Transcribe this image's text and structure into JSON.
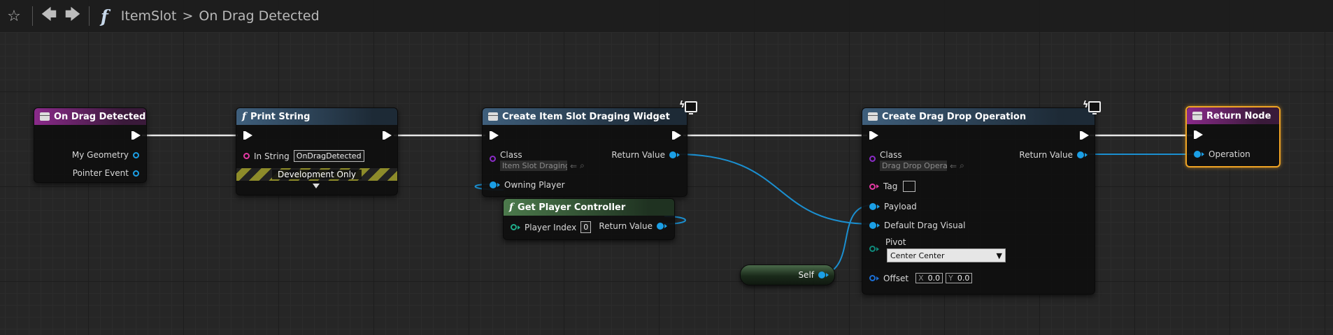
{
  "toolbar": {
    "breadcrumb": {
      "blueprint": "ItemSlot",
      "separator": ">",
      "function": "On Drag Detected"
    },
    "icons": [
      "star-icon",
      "back-arrow-icon",
      "forward-arrow-icon",
      "function-icon"
    ]
  },
  "nodes": {
    "on_drag_detected": {
      "title": "On Drag Detected",
      "pins": {
        "my_geometry": "My Geometry",
        "pointer_event": "Pointer Event"
      }
    },
    "print_string": {
      "title": "Print String",
      "in_string_label": "In String",
      "in_string_value": "OnDragDetected",
      "dev_only": "Development Only"
    },
    "create_widget": {
      "title": "Create Item Slot Draging Widget",
      "class_label": "Class",
      "class_value": "Item Slot Draging",
      "return_value": "Return Value",
      "owning_player": "Owning Player"
    },
    "get_player_controller": {
      "title": "Get Player Controller",
      "player_index_label": "Player Index",
      "player_index_value": "0",
      "return_value": "Return Value"
    },
    "create_drag_drop": {
      "title": "Create Drag Drop Operation",
      "class_label": "Class",
      "class_value": "Drag Drop Operat",
      "return_value": "Return Value",
      "tag": "Tag",
      "payload": "Payload",
      "default_drag_visual": "Default Drag Visual",
      "pivot": "Pivot",
      "pivot_value": "Center Center",
      "offset": "Offset",
      "offset_x_label": "X",
      "offset_x": "0.0",
      "offset_y_label": "Y",
      "offset_y": "0.0"
    },
    "self": {
      "label": "Self"
    },
    "return_node": {
      "title": "Return Node",
      "operation": "Operation"
    }
  },
  "colors": {
    "event_header": "#8a2a8a",
    "function_header": "#3f5f7c",
    "pure_header": "#4c7a4c",
    "object_pin": "#1b9fe6",
    "class_pin": "#8b2cc7",
    "string_pin": "#e63aa5",
    "return_highlight": "#f0a424"
  }
}
